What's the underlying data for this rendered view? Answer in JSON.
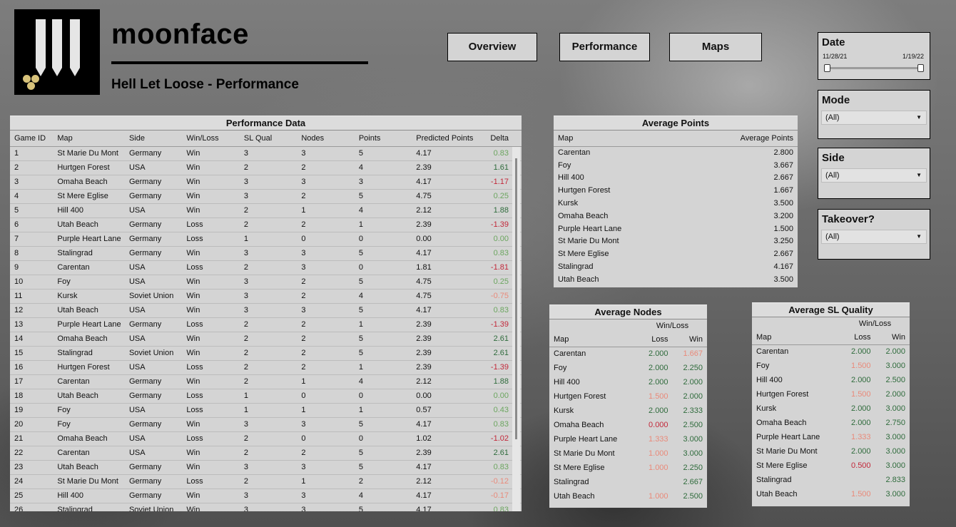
{
  "brand": "moonface",
  "subtitle": "Hell Let Loose - Performance",
  "nav": [
    "Overview",
    "Performance",
    "Maps"
  ],
  "filters": {
    "date": {
      "title": "Date",
      "start": "11/28/21",
      "end": "1/19/22"
    },
    "mode": {
      "title": "Mode",
      "value": "(All)"
    },
    "side": {
      "title": "Side",
      "value": "(All)"
    },
    "takeover": {
      "title": "Takeover?",
      "value": "(All)"
    }
  },
  "performance": {
    "title": "Performance Data",
    "columns": [
      "Game ID",
      "Map",
      "Side",
      "Win/Loss",
      "SL Qual",
      "Nodes",
      "Points",
      "Predicted Points",
      "Delta"
    ],
    "rows": [
      [
        "1",
        "St Marie Du Mont",
        "Germany",
        "Win",
        "3",
        "3",
        "5",
        "4.17",
        "0.83"
      ],
      [
        "2",
        "Hurtgen Forest",
        "USA",
        "Win",
        "2",
        "2",
        "4",
        "2.39",
        "1.61"
      ],
      [
        "3",
        "Omaha Beach",
        "Germany",
        "Win",
        "3",
        "3",
        "3",
        "4.17",
        "-1.17"
      ],
      [
        "4",
        "St Mere Eglise",
        "Germany",
        "Win",
        "3",
        "2",
        "5",
        "4.75",
        "0.25"
      ],
      [
        "5",
        "Hill 400",
        "USA",
        "Win",
        "2",
        "1",
        "4",
        "2.12",
        "1.88"
      ],
      [
        "6",
        "Utah Beach",
        "Germany",
        "Loss",
        "2",
        "2",
        "1",
        "2.39",
        "-1.39"
      ],
      [
        "7",
        "Purple Heart Lane",
        "Germany",
        "Loss",
        "1",
        "0",
        "0",
        "0.00",
        "0.00"
      ],
      [
        "8",
        "Stalingrad",
        "Germany",
        "Win",
        "3",
        "3",
        "5",
        "4.17",
        "0.83"
      ],
      [
        "9",
        "Carentan",
        "USA",
        "Loss",
        "2",
        "3",
        "0",
        "1.81",
        "-1.81"
      ],
      [
        "10",
        "Foy",
        "USA",
        "Win",
        "3",
        "2",
        "5",
        "4.75",
        "0.25"
      ],
      [
        "11",
        "Kursk",
        "Soviet Union",
        "Win",
        "3",
        "2",
        "4",
        "4.75",
        "-0.75"
      ],
      [
        "12",
        "Utah Beach",
        "USA",
        "Win",
        "3",
        "3",
        "5",
        "4.17",
        "0.83"
      ],
      [
        "13",
        "Purple Heart Lane",
        "Germany",
        "Loss",
        "2",
        "2",
        "1",
        "2.39",
        "-1.39"
      ],
      [
        "14",
        "Omaha Beach",
        "USA",
        "Win",
        "2",
        "2",
        "5",
        "2.39",
        "2.61"
      ],
      [
        "15",
        "Stalingrad",
        "Soviet Union",
        "Win",
        "2",
        "2",
        "5",
        "2.39",
        "2.61"
      ],
      [
        "16",
        "Hurtgen Forest",
        "USA",
        "Loss",
        "2",
        "2",
        "1",
        "2.39",
        "-1.39"
      ],
      [
        "17",
        "Carentan",
        "Germany",
        "Win",
        "2",
        "1",
        "4",
        "2.12",
        "1.88"
      ],
      [
        "18",
        "Utah Beach",
        "Germany",
        "Loss",
        "1",
        "0",
        "0",
        "0.00",
        "0.00"
      ],
      [
        "19",
        "Foy",
        "USA",
        "Loss",
        "1",
        "1",
        "1",
        "0.57",
        "0.43"
      ],
      [
        "20",
        "Foy",
        "Germany",
        "Win",
        "3",
        "3",
        "5",
        "4.17",
        "0.83"
      ],
      [
        "21",
        "Omaha Beach",
        "USA",
        "Loss",
        "2",
        "0",
        "0",
        "1.02",
        "-1.02"
      ],
      [
        "22",
        "Carentan",
        "USA",
        "Win",
        "2",
        "2",
        "5",
        "2.39",
        "2.61"
      ],
      [
        "23",
        "Utah Beach",
        "Germany",
        "Win",
        "3",
        "3",
        "5",
        "4.17",
        "0.83"
      ],
      [
        "24",
        "St Marie Du Mont",
        "Germany",
        "Loss",
        "2",
        "1",
        "2",
        "2.12",
        "-0.12"
      ],
      [
        "25",
        "Hill 400",
        "Germany",
        "Win",
        "3",
        "3",
        "4",
        "4.17",
        "-0.17"
      ],
      [
        "26",
        "Stalingrad",
        "Soviet Union",
        "Win",
        "3",
        "3",
        "5",
        "4.17",
        "0.83"
      ]
    ],
    "delta_colors": [
      "lg",
      "dg",
      "rd",
      "lg",
      "dg",
      "rd",
      "lg",
      "lg",
      "rd",
      "lg",
      "pk",
      "lg",
      "rd",
      "dg",
      "dg",
      "rd",
      "dg",
      "lg",
      "lg",
      "lg",
      "rd",
      "dg",
      "lg",
      "pk",
      "pk",
      "lg"
    ]
  },
  "avg_points": {
    "title": "Average Points",
    "columns": [
      "Map",
      "Average Points"
    ],
    "rows": [
      [
        "Carentan",
        "2.800"
      ],
      [
        "Foy",
        "3.667"
      ],
      [
        "Hill 400",
        "2.667"
      ],
      [
        "Hurtgen Forest",
        "1.667"
      ],
      [
        "Kursk",
        "3.500"
      ],
      [
        "Omaha Beach",
        "3.200"
      ],
      [
        "Purple Heart Lane",
        "1.500"
      ],
      [
        "St Marie Du Mont",
        "3.250"
      ],
      [
        "St Mere Eglise",
        "2.667"
      ],
      [
        "Stalingrad",
        "4.167"
      ],
      [
        "Utah Beach",
        "3.500"
      ]
    ]
  },
  "avg_nodes": {
    "title": "Average Nodes",
    "group": "Win/Loss",
    "columns": [
      "Map",
      "Loss",
      "Win"
    ],
    "rows": [
      [
        "Carentan",
        "2.000",
        "1.667"
      ],
      [
        "Foy",
        "2.000",
        "2.250"
      ],
      [
        "Hill 400",
        "2.000",
        "2.000"
      ],
      [
        "Hurtgen Forest",
        "1.500",
        "2.000"
      ],
      [
        "Kursk",
        "2.000",
        "2.333"
      ],
      [
        "Omaha Beach",
        "0.000",
        "2.500"
      ],
      [
        "Purple Heart Lane",
        "1.333",
        "3.000"
      ],
      [
        "St Marie Du Mont",
        "1.000",
        "3.000"
      ],
      [
        "St Mere Eglise",
        "1.000",
        "2.250"
      ],
      [
        "Stalingrad",
        "",
        "2.667"
      ],
      [
        "Utah Beach",
        "1.000",
        "2.500"
      ]
    ],
    "colors": [
      [
        "dg",
        "pk"
      ],
      [
        "dg",
        "dg"
      ],
      [
        "dg",
        "dg"
      ],
      [
        "pk",
        "dg"
      ],
      [
        "dg",
        "dg"
      ],
      [
        "rd",
        "dg"
      ],
      [
        "pk",
        "dg"
      ],
      [
        "pk",
        "dg"
      ],
      [
        "pk",
        "dg"
      ],
      [
        "",
        "dg"
      ],
      [
        "pk",
        "dg"
      ]
    ]
  },
  "avg_sl": {
    "title": "Average SL Quality",
    "group": "Win/Loss",
    "columns": [
      "Map",
      "Loss",
      "Win"
    ],
    "rows": [
      [
        "Carentan",
        "2.000",
        "2.000"
      ],
      [
        "Foy",
        "1.500",
        "3.000"
      ],
      [
        "Hill 400",
        "2.000",
        "2.500"
      ],
      [
        "Hurtgen Forest",
        "1.500",
        "2.000"
      ],
      [
        "Kursk",
        "2.000",
        "3.000"
      ],
      [
        "Omaha Beach",
        "2.000",
        "2.750"
      ],
      [
        "Purple Heart Lane",
        "1.333",
        "3.000"
      ],
      [
        "St Marie Du Mont",
        "2.000",
        "3.000"
      ],
      [
        "St Mere Eglise",
        "0.500",
        "3.000"
      ],
      [
        "Stalingrad",
        "",
        "2.833"
      ],
      [
        "Utah Beach",
        "1.500",
        "3.000"
      ]
    ],
    "colors": [
      [
        "dg",
        "dg"
      ],
      [
        "pk",
        "dg"
      ],
      [
        "dg",
        "dg"
      ],
      [
        "pk",
        "dg"
      ],
      [
        "dg",
        "dg"
      ],
      [
        "dg",
        "dg"
      ],
      [
        "pk",
        "dg"
      ],
      [
        "dg",
        "dg"
      ],
      [
        "rd",
        "dg"
      ],
      [
        "",
        "dg"
      ],
      [
        "pk",
        "dg"
      ]
    ]
  }
}
